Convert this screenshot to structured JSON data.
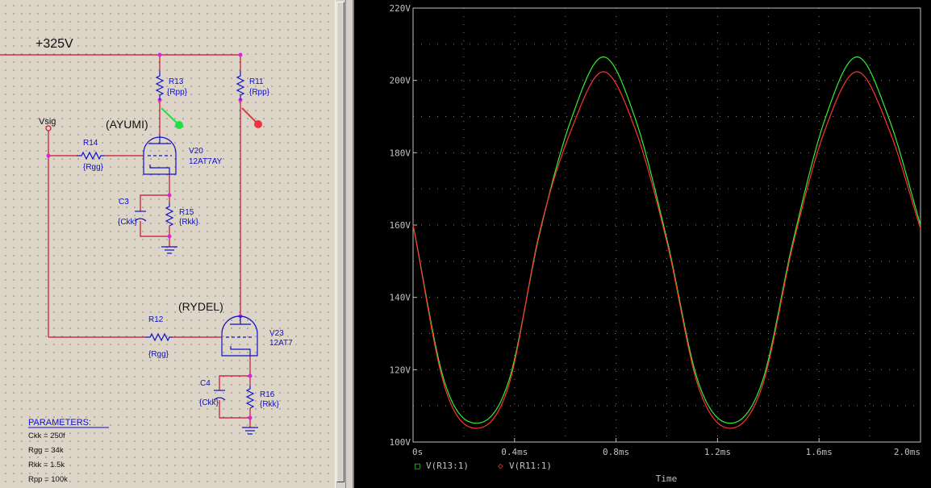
{
  "schematic": {
    "supply_label": "+325V",
    "vsig_label": "Vsig",
    "tube_top_name": "(AYUMI)",
    "tube_bottom_name": "(RYDEL)",
    "parts": {
      "r13": {
        "ref": "R13",
        "val": "{Rpp}"
      },
      "r11": {
        "ref": "R11",
        "val": "{Rpp}"
      },
      "r14": {
        "ref": "R14",
        "val": "{Rgg}"
      },
      "r12": {
        "ref": "R12",
        "val": "{Rgg}"
      },
      "r15": {
        "ref": "R15",
        "val": "{Rkk}"
      },
      "r16": {
        "ref": "R16",
        "val": "{Rkk}"
      },
      "c3": {
        "ref": "C3",
        "val": "{Ckk}"
      },
      "c4": {
        "ref": "C4",
        "val": "{Ckk}"
      },
      "v20": {
        "ref": "V20",
        "val": "12AT7AY"
      },
      "v23": {
        "ref": "V23",
        "val": "12AT7"
      }
    },
    "parameters": {
      "title": "PARAMETERS:",
      "lines": [
        "Ckk = 250f",
        "Rgg = 34k",
        "Rkk = 1.5k",
        "Rpp = 100k"
      ]
    },
    "colors": {
      "wire": "#c8102e",
      "component": "#1010c8",
      "node": "#e020e0",
      "probe_green": "#22dd44",
      "probe_red": "#ee3344"
    }
  },
  "chart_data": {
    "type": "line",
    "x_ticks": [
      "0s",
      "0.4ms",
      "0.8ms",
      "1.2ms",
      "1.6ms",
      "2.0ms"
    ],
    "y_ticks": [
      "100V",
      "120V",
      "140V",
      "160V",
      "180V",
      "200V",
      "220V"
    ],
    "xlim": [
      0,
      2.0
    ],
    "ylim": [
      100,
      220
    ],
    "xlabel": "Time",
    "x_unit": "ms",
    "grid": true,
    "series": [
      {
        "name": "V(R13:1)",
        "color": "#33ee33",
        "marker": "□",
        "x": [
          0,
          0.125,
          0.25,
          0.375,
          0.5,
          0.625,
          0.75,
          0.875,
          1.0,
          1.125,
          1.25,
          1.375,
          1.5,
          1.625,
          1.75,
          1.875,
          2.0
        ],
        "y": [
          160,
          116.4,
          105.2,
          116.4,
          158,
          189.6,
          206.5,
          189.6,
          156.2,
          116.4,
          105.2,
          116.4,
          156.3,
          189.6,
          206.5,
          189.6,
          160
        ]
      },
      {
        "name": "V(R11:1)",
        "color": "#ff3333",
        "marker": "◇",
        "x": [
          0,
          0.125,
          0.25,
          0.375,
          0.5,
          0.625,
          0.75,
          0.875,
          1.0,
          1.125,
          1.25,
          1.375,
          1.5,
          1.625,
          1.75,
          1.875,
          2.0
        ],
        "y": [
          160,
          115.2,
          103.8,
          115.2,
          158.5,
          186.6,
          202.4,
          186.6,
          155.4,
          115.2,
          103.8,
          115.2,
          155.3,
          186.6,
          202.4,
          186.6,
          159
        ]
      }
    ]
  }
}
